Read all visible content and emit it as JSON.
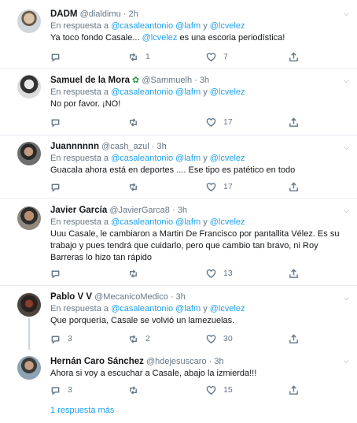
{
  "tweets": [
    {
      "name": "DADM",
      "handle": "@dialdimu",
      "time": "2h",
      "reply_prefix": "En respuesta a",
      "mentions": "@casaleantonio @lafm",
      "conj": "y",
      "mention_last": "@lcvelez",
      "text_before": "Ya toco fondo Casale... ",
      "text_mention": "@lcvelez",
      "text_after": " es una escoria periodística!",
      "replies": "",
      "retweets": "1",
      "likes": "7"
    },
    {
      "name": "Samuel de la Mora",
      "handle": "@Sammuelh",
      "time": "3h",
      "reply_prefix": "En respuesta a",
      "mentions": "@casaleantonio @lafm",
      "conj": "y",
      "mention_last": "@lcvelez",
      "text": "No por favor. ¡NO!",
      "replies": "",
      "retweets": "",
      "likes": "17"
    },
    {
      "name": "Juannnnnn",
      "handle": "@cash_azul",
      "time": "3h",
      "reply_prefix": "En respuesta a",
      "mentions": "@casaleantonio @lafm",
      "conj": "y",
      "mention_last": "@lcvelez",
      "text": "Guacala ahora está en deportes .... Ese tipo es patético en todo",
      "replies": "",
      "retweets": "",
      "likes": "17"
    },
    {
      "name": "Javier García",
      "handle": "@JavierGarca8",
      "time": "3h",
      "reply_prefix": "En respuesta a",
      "mentions": "@casaleantonio @lafm",
      "conj": "y",
      "mention_last": "@lcvelez",
      "text_lines": [
        "Uuu Casale, le cambiaron a Martin De Francisco por pantallita Vélez. Es su",
        "trabajo y pues tendrá que cuidarlo, pero que cambio tan bravo, ni Roy",
        "Barreras lo hizo tan rápido"
      ],
      "replies": "",
      "retweets": "",
      "likes": "13"
    },
    {
      "name": "Pablo V V",
      "handle": "@MecanicoMedico",
      "time": "3h",
      "reply_prefix": "En respuesta a",
      "mentions": "@casaleantonio @lafm",
      "conj": "y",
      "mention_last": "@lcvelez",
      "text": "Que porquería, Casale se volvió un lamezuelas.",
      "replies": "3",
      "retweets": "2",
      "likes": "30"
    },
    {
      "name": "Hernán Caro Sánchez",
      "handle": "@hdejesuscaro",
      "time": "3h",
      "text": "Ahora si voy a escuchar a Casale, abajo la izmierda!!!",
      "replies": "3",
      "retweets": "",
      "likes": "15"
    }
  ],
  "more_replies": "1 respuesta más",
  "icons": {
    "reply": "reply-icon",
    "retweet": "retweet-icon",
    "like": "heart-icon",
    "share": "share-icon",
    "caret": "chevron-down-icon",
    "badge": "plant-emoji-icon"
  },
  "colors": {
    "link": "#1da1f2",
    "muted": "#657786",
    "border": "#e6ecf0"
  }
}
